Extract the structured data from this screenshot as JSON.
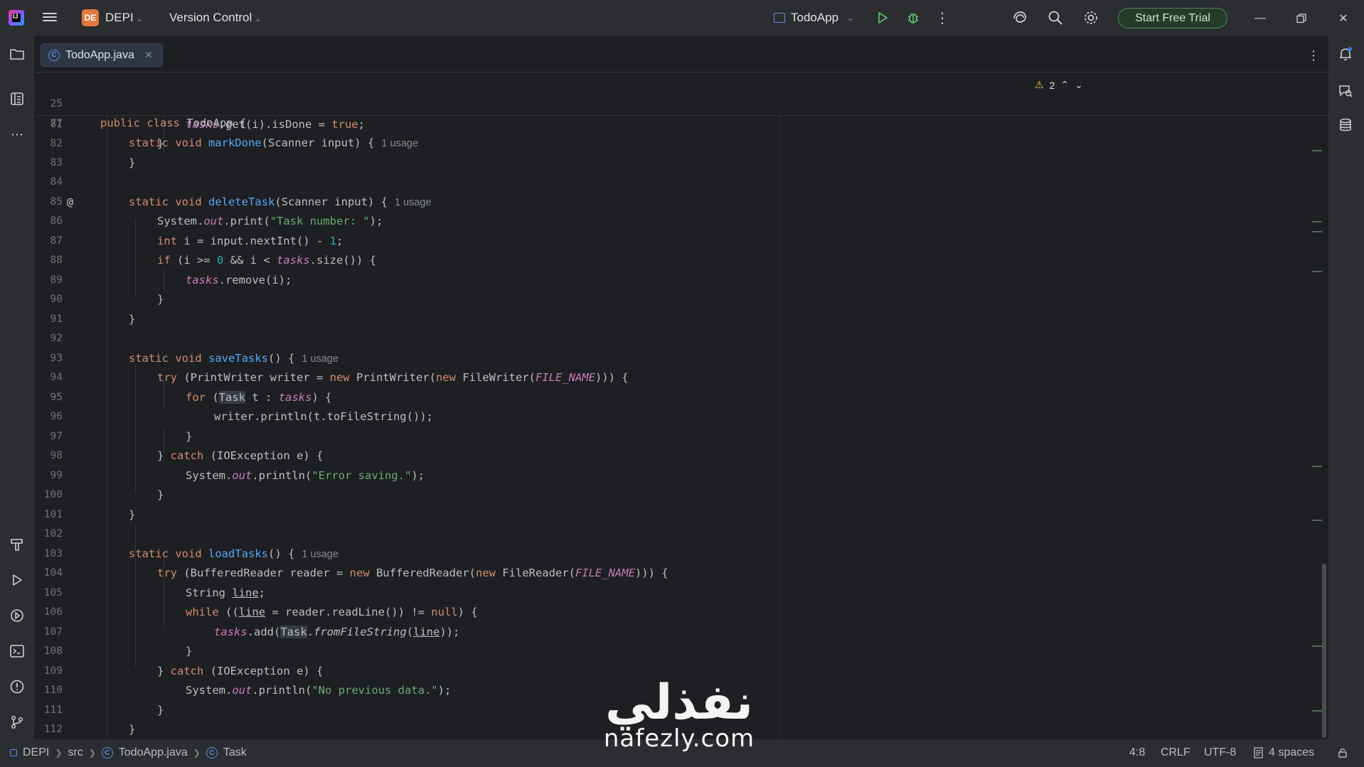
{
  "titlebar": {
    "project_initials": "DE",
    "project_name": "DEPI",
    "vcs_label": "Version Control",
    "run_config": "TodoApp",
    "trial_button": "Start Free Trial"
  },
  "editor": {
    "tab_label": "TodoApp.java",
    "warnings_count": "2",
    "lines": [
      {
        "n": "25",
        "sticky": true
      },
      {
        "n": "77",
        "sticky": true
      },
      {
        "n": "81"
      },
      {
        "n": "82"
      },
      {
        "n": "83"
      },
      {
        "n": "84"
      },
      {
        "n": "85"
      },
      {
        "n": "86"
      },
      {
        "n": "87"
      },
      {
        "n": "88"
      },
      {
        "n": "89"
      },
      {
        "n": "90"
      },
      {
        "n": "91"
      },
      {
        "n": "92"
      },
      {
        "n": "93"
      },
      {
        "n": "94"
      },
      {
        "n": "95"
      },
      {
        "n": "96"
      },
      {
        "n": "97"
      },
      {
        "n": "98"
      },
      {
        "n": "99"
      },
      {
        "n": "100"
      },
      {
        "n": "101"
      },
      {
        "n": "102"
      },
      {
        "n": "103"
      },
      {
        "n": "104"
      },
      {
        "n": "105"
      },
      {
        "n": "106"
      },
      {
        "n": "107"
      },
      {
        "n": "108"
      },
      {
        "n": "109"
      },
      {
        "n": "110"
      },
      {
        "n": "111"
      },
      {
        "n": "112"
      }
    ],
    "code": {
      "l25": "public class TodoApp {",
      "l77_a": "static void ",
      "l77_fn": "markDone",
      "l77_b": "(Scanner input) {",
      "l77_hint": "1 usage",
      "l81_fld": "tasks",
      "l81_b": ".get(i).isDone = ",
      "l81_kw": "true",
      "l81_c": ";",
      "l85_a": "static void ",
      "l85_fn": "deleteTask",
      "l85_b": "(Scanner input) {",
      "l85_hint": "1 usage",
      "l86_a": "System.",
      "l86_out": "out",
      "l86_b": ".print(",
      "l86_str": "\"Task number: \"",
      "l86_c": ");",
      "l87_kw": "int",
      "l87_a": " i = input.nextInt() - ",
      "l87_num": "1",
      "l87_b": ";",
      "l88_kw": "if",
      "l88_a": " (i >= ",
      "l88_num": "0",
      "l88_b": " && i < ",
      "l88_fld": "tasks",
      "l88_c": ".size()) {",
      "l89_fld": "tasks",
      "l89_a": ".remove(i);",
      "l93_a": "static void ",
      "l93_fn": "saveTasks",
      "l93_b": "() {",
      "l93_hint": "1 usage",
      "l94_kw": "try",
      "l94_a": " (PrintWriter writer = ",
      "l94_new": "new",
      "l94_b": " PrintWriter(",
      "l94_new2": "new",
      "l94_c": " FileWriter(",
      "l94_cst": "FILE_NAME",
      "l94_d": "))) {",
      "l95_kw": "for",
      "l95_a": " (",
      "l95_task": "Task",
      "l95_b": " t : ",
      "l95_fld": "tasks",
      "l95_c": ") {",
      "l96": "writer.println(t.toFileString());",
      "l98_a": "} ",
      "l98_kw": "catch",
      "l98_b": " (IOException e) {",
      "l99_a": "System.",
      "l99_out": "out",
      "l99_b": ".println(",
      "l99_str": "\"Error saving.\"",
      "l99_c": ");",
      "l103_a": "static void ",
      "l103_fn": "loadTasks",
      "l103_b": "() {",
      "l103_hint": "1 usage",
      "l104_kw": "try",
      "l104_a": " (BufferedReader reader = ",
      "l104_new": "new",
      "l104_b": " BufferedReader(",
      "l104_new2": "new",
      "l104_c": " FileReader(",
      "l104_cst": "FILE_NAME",
      "l104_d": "))) {",
      "l105_a": "String ",
      "l105_var": "line",
      "l105_b": ";",
      "l106_kw": "while",
      "l106_a": " ((",
      "l106_var": "line",
      "l106_b": " = reader.readLine()) != ",
      "l106_null": "null",
      "l106_c": ") {",
      "l107_fld": "tasks",
      "l107_a": ".add(",
      "l107_task": "Task",
      "l107_b": ".",
      "l107_st": "fromFileString",
      "l107_c": "(",
      "l107_var": "line",
      "l107_d": "));",
      "l109_a": "} ",
      "l109_kw": "catch",
      "l109_b": " (IOException e) {",
      "l110_a": "System.",
      "l110_out": "out",
      "l110_b": ".println(",
      "l110_str": "\"No previous data.\"",
      "l110_c": ");",
      "brace_open": "{",
      "brace_close": "}"
    }
  },
  "watermark": {
    "arabic": "نفذلي",
    "latin": "nafezly.com"
  },
  "statusbar": {
    "crumbs": [
      "DEPI",
      "src",
      "TodoApp.java",
      "Task"
    ],
    "position": "4:8",
    "line_sep": "CRLF",
    "encoding": "UTF-8",
    "indent": "4 spaces"
  },
  "colors": {
    "accent": "#3574f0",
    "trial_green": "#4e8a56",
    "keyword": "#cf8e6d",
    "function": "#56a8f5",
    "string": "#6aab73",
    "number": "#2aacb8",
    "field": "#c77dbb"
  },
  "icons": [
    "app-logo-icon",
    "hamburger-menu-icon",
    "run-icon",
    "debug-icon",
    "more-icon",
    "ai-assistant-icon",
    "search-icon",
    "settings-icon",
    "minimize-icon",
    "restore-icon",
    "close-icon",
    "project-folder-icon",
    "structure-icon",
    "more-tools-icon",
    "build-icon",
    "run-tool-icon",
    "services-icon",
    "terminal-icon",
    "problems-icon",
    "git-icon",
    "notifications-icon",
    "ai-chat-icon",
    "database-icon",
    "warning-icon",
    "lock-icon"
  ]
}
